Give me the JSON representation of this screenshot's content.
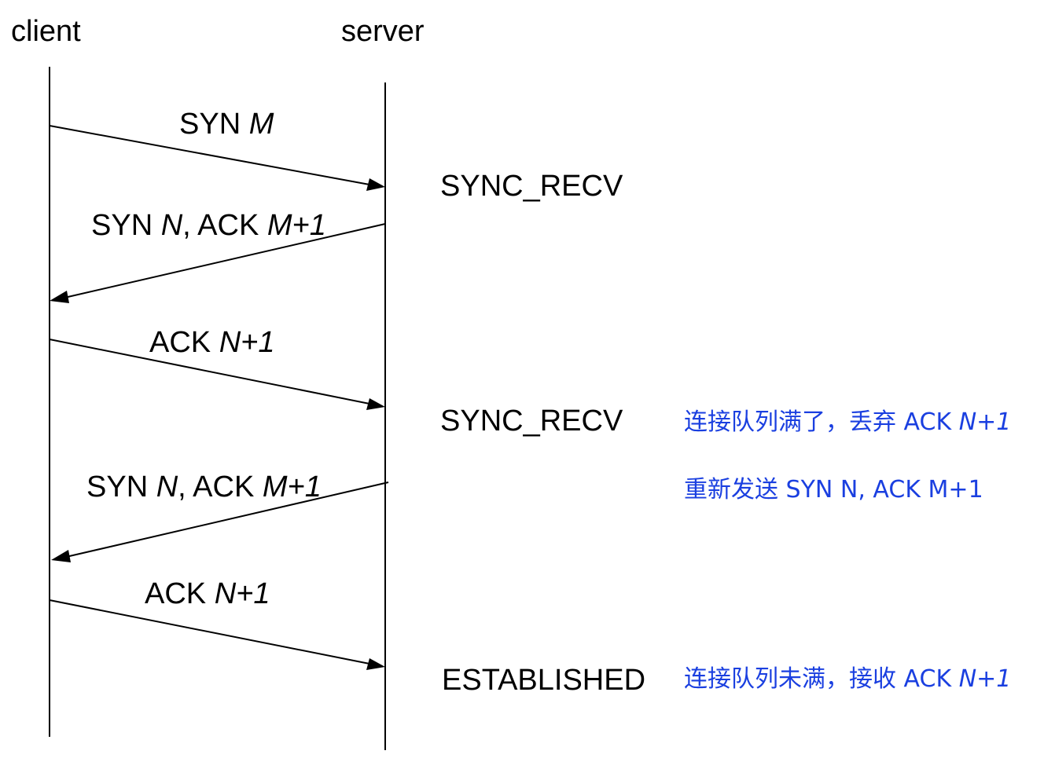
{
  "actors": {
    "client": "client",
    "server": "server"
  },
  "messages": [
    {
      "name": "SYN ",
      "value": "M"
    },
    {
      "name": "SYN ",
      "value": "N",
      "rest": ", ACK ",
      "rest_value": "M+1"
    },
    {
      "name": "ACK ",
      "value": "N+1"
    },
    {
      "name": "SYN ",
      "value": "N",
      "rest": ", ACK ",
      "rest_value": "M+1"
    },
    {
      "name": "ACK ",
      "value": "N+1"
    }
  ],
  "states": [
    "SYNC_RECV",
    "SYNC_RECV",
    "ESTABLISHED"
  ],
  "notes": [
    {
      "text": "连接队列满了，丢弃 ACK ",
      "value": "N+1"
    },
    {
      "text": "重新发送 SYN N, ACK M+1"
    },
    {
      "text": "连接队列未满，接收 ACK ",
      "value": "N+1"
    }
  ],
  "colors": {
    "note": "#1a3fe0",
    "line": "#000000"
  }
}
